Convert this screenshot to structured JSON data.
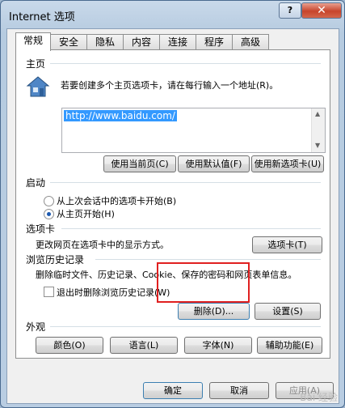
{
  "window": {
    "title": "Internet 选项",
    "help": "?",
    "close": "✕"
  },
  "tabs": [
    "常规",
    "安全",
    "隐私",
    "内容",
    "连接",
    "程序",
    "高级"
  ],
  "home": {
    "heading": "主页",
    "icon": "home-icon",
    "instruction": "若要创建多个主页选项卡，请在每行输入一个地址(R)。",
    "url": "http://www.baidu.com/",
    "btn_current": "使用当前页(C)",
    "btn_default": "使用默认值(F)",
    "btn_newtab": "使用新选项卡(U)"
  },
  "startup": {
    "heading": "启动",
    "opt_last": "从上次会话中的选项卡开始(B)",
    "opt_home": "从主页开始(H)",
    "selected": "opt_home"
  },
  "tabs_section": {
    "heading": "选项卡",
    "desc": "更改网页在选项卡中的显示方式。",
    "btn": "选项卡(T)"
  },
  "history": {
    "heading": "浏览历史记录",
    "desc": "删除临时文件、历史记录、Cookie、保存的密码和网页表单信息。",
    "checkbox": "退出时删除浏览历史记录(W)",
    "checked": false,
    "btn_delete": "删除(D)...",
    "btn_settings": "设置(S)"
  },
  "appearance": {
    "heading": "外观",
    "btn_colors": "颜色(O)",
    "btn_languages": "语言(L)",
    "btn_fonts": "字体(N)",
    "btn_accessibility": "辅助功能(E)"
  },
  "footer": {
    "ok": "确定",
    "cancel": "取消",
    "apply": "应用(A)"
  },
  "watermark": "Bai 经验",
  "colors": {
    "highlight": "#e02020",
    "selection": "#3399ff"
  }
}
